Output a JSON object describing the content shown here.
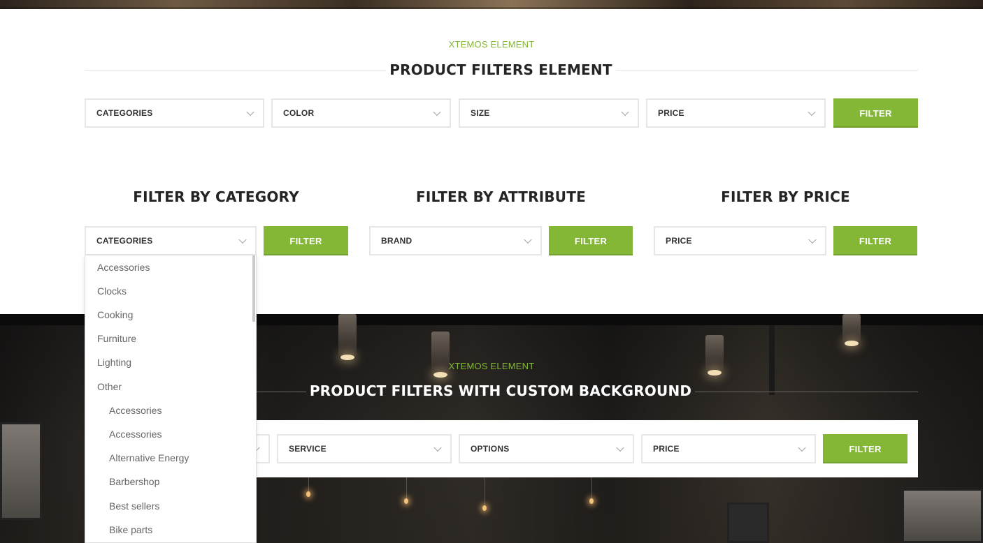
{
  "colors": {
    "accent": "#83b735",
    "title": "#242424"
  },
  "section1": {
    "eyebrow": "XTEMOS ELEMENT",
    "title": "PRODUCT FILTERS ELEMENT",
    "selects": [
      "CATEGORIES",
      "COLOR",
      "SIZE",
      "PRICE"
    ],
    "filter_button": "FILTER"
  },
  "section2": {
    "columns": [
      {
        "title": "FILTER BY CATEGORY",
        "select": "CATEGORIES",
        "button": "FILTER"
      },
      {
        "title": "FILTER BY ATTRIBUTE",
        "select": "BRAND",
        "button": "FILTER"
      },
      {
        "title": "FILTER BY PRICE",
        "select": "PRICE",
        "button": "FILTER"
      }
    ]
  },
  "dropdown": {
    "items": [
      {
        "label": "Accessories"
      },
      {
        "label": "Clocks"
      },
      {
        "label": "Cooking"
      },
      {
        "label": "Furniture"
      },
      {
        "label": "Lighting"
      },
      {
        "label": "Other"
      },
      {
        "label": "Accessories"
      },
      {
        "label": "Accessories"
      },
      {
        "label": "Alternative Energy"
      },
      {
        "label": "Barbershop"
      },
      {
        "label": "Best sellers"
      },
      {
        "label": "Bike parts"
      }
    ]
  },
  "section3": {
    "eyebrow": "XTEMOS ELEMENT",
    "title": "PRODUCT FILTERS WITH CUSTOM BACKGROUND",
    "selects": [
      "SERVICE",
      "OPTIONS",
      "PRICE"
    ],
    "filter_button": "FILTER"
  }
}
